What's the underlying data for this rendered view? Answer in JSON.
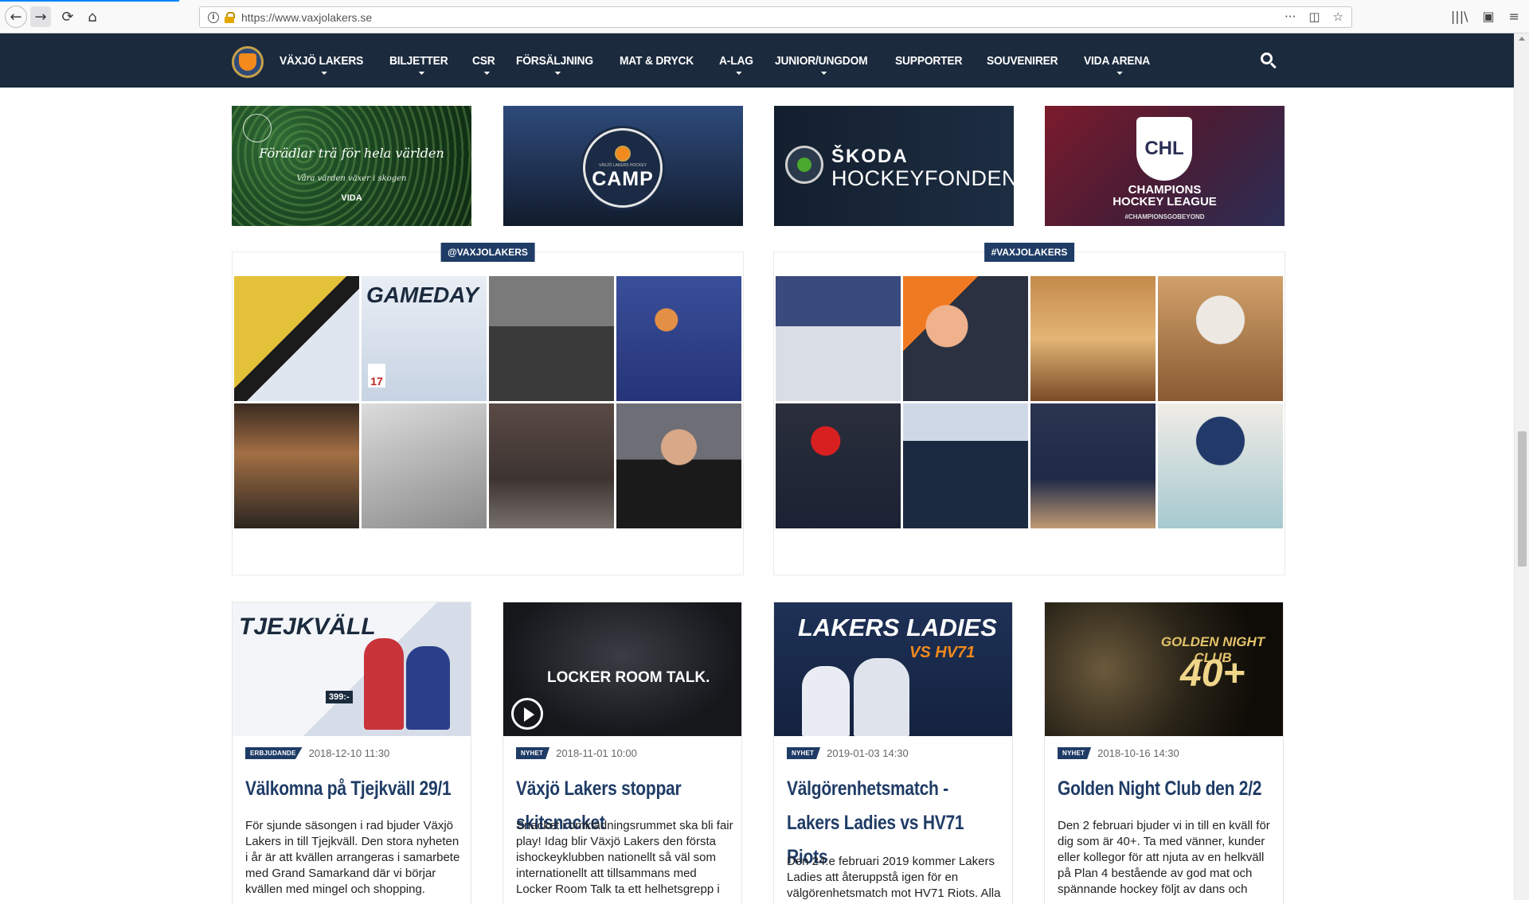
{
  "browser": {
    "url": "https://www.vaxjolakers.se",
    "back_icon": "←",
    "forward_icon": "→",
    "reload_icon": "⟳",
    "home_icon": "⌂",
    "page_actions": "···",
    "pocket_icon": "◫",
    "star_icon": "☆",
    "library_icon": "|||\\",
    "sidebar_icon": "▣",
    "menu_icon": "≡"
  },
  "nav": {
    "items": [
      {
        "label": "VÄXJÖ LAKERS",
        "sub": true
      },
      {
        "label": "BILJETTER",
        "sub": true
      },
      {
        "label": "CSR",
        "sub": true
      },
      {
        "label": "FÖRSÄLJNING",
        "sub": true
      },
      {
        "label": "MAT & DRYCK",
        "sub": false
      },
      {
        "label": "A-LAG",
        "sub": true
      },
      {
        "label": "JUNIOR/UNGDOM",
        "sub": true
      },
      {
        "label": "SUPPORTER",
        "sub": false
      },
      {
        "label": "SOUVENIRER",
        "sub": false
      },
      {
        "label": "VIDA ARENA",
        "sub": true
      }
    ]
  },
  "sponsors": {
    "vida": {
      "title": "Förädlar trä för hela världen",
      "subtitle": "Våra värden växer i skogen",
      "logo": "VIDA"
    },
    "camp": {
      "small": "VÄXJÖ LAKERS HOCKEY",
      "word": "CAMP"
    },
    "skoda": {
      "line1": "ŠKODA",
      "line2": "HOCKEYFONDEN"
    },
    "chl": {
      "badge": "CHL",
      "line1": "CHAMPIONS",
      "line2": "HOCKEY LEAGUE",
      "tag": "#CHAMPIONSGOBEYOND"
    }
  },
  "feeds": {
    "left_label": "@VAXJOLAKERS",
    "right_label": "#VAXJOLAKERS",
    "gameday_caption": "GAMEDAY",
    "gameday_date": "17"
  },
  "articles": [
    {
      "tag": "ERBJUDANDE",
      "date": "2018-12-10 11:30",
      "title": "Välkomna på Tjejkväll 29/1",
      "body": "För sjunde säsongen i rad bjuder Växjö Lakers in till Tjejkväll. Den stora nyheten i år är att kvällen arrangeras i samarbete med Grand Samarkand där vi börjar kvällen med mingel och shopping.",
      "image_text": "TJEJKVÄLL",
      "image_price": "399:-"
    },
    {
      "tag": "NYHET",
      "date": "2018-11-01 10:00",
      "title": "Växjö Lakers stoppar skitsnacket",
      "body": "Snacket i omklädningsrummet ska bli fair play! Idag blir Växjö Lakers den första ishockeyklubben nationellt så väl som internationellt att tillsammans med Locker Room Talk ta ett helhetsgrepp i",
      "image_text": "LOCKER ROOM TALK."
    },
    {
      "tag": "NYHET",
      "date": "2019-01-03 14:30",
      "title": "Välgörenhetsmatch - Lakers Ladies vs HV71 Riots",
      "body": "Den 24:e februari 2019 kommer Lakers Ladies att återuppstå igen för en välgörenhetsmatch mot HV71 Riots. Alla",
      "image_text": "LAKERS LADIES",
      "image_sub": "VS HV71"
    },
    {
      "tag": "NYHET",
      "date": "2018-10-16 14:30",
      "title": "Golden Night Club den 2/2",
      "body": "Den 2 februari bjuder vi in till en kväll för dig som är 40+. Ta med vänner, kunder eller kollegor för att njuta av en helkväll på Plan 4 bestående av god mat och spännande hockey följt av dans och",
      "image_text": "GOLDEN NIGHT CLUB",
      "image_big": "40+"
    }
  ],
  "colors": {
    "navy": "#1b2a3d",
    "brand_blue": "#1f3c66",
    "orange": "#f28a1c"
  }
}
